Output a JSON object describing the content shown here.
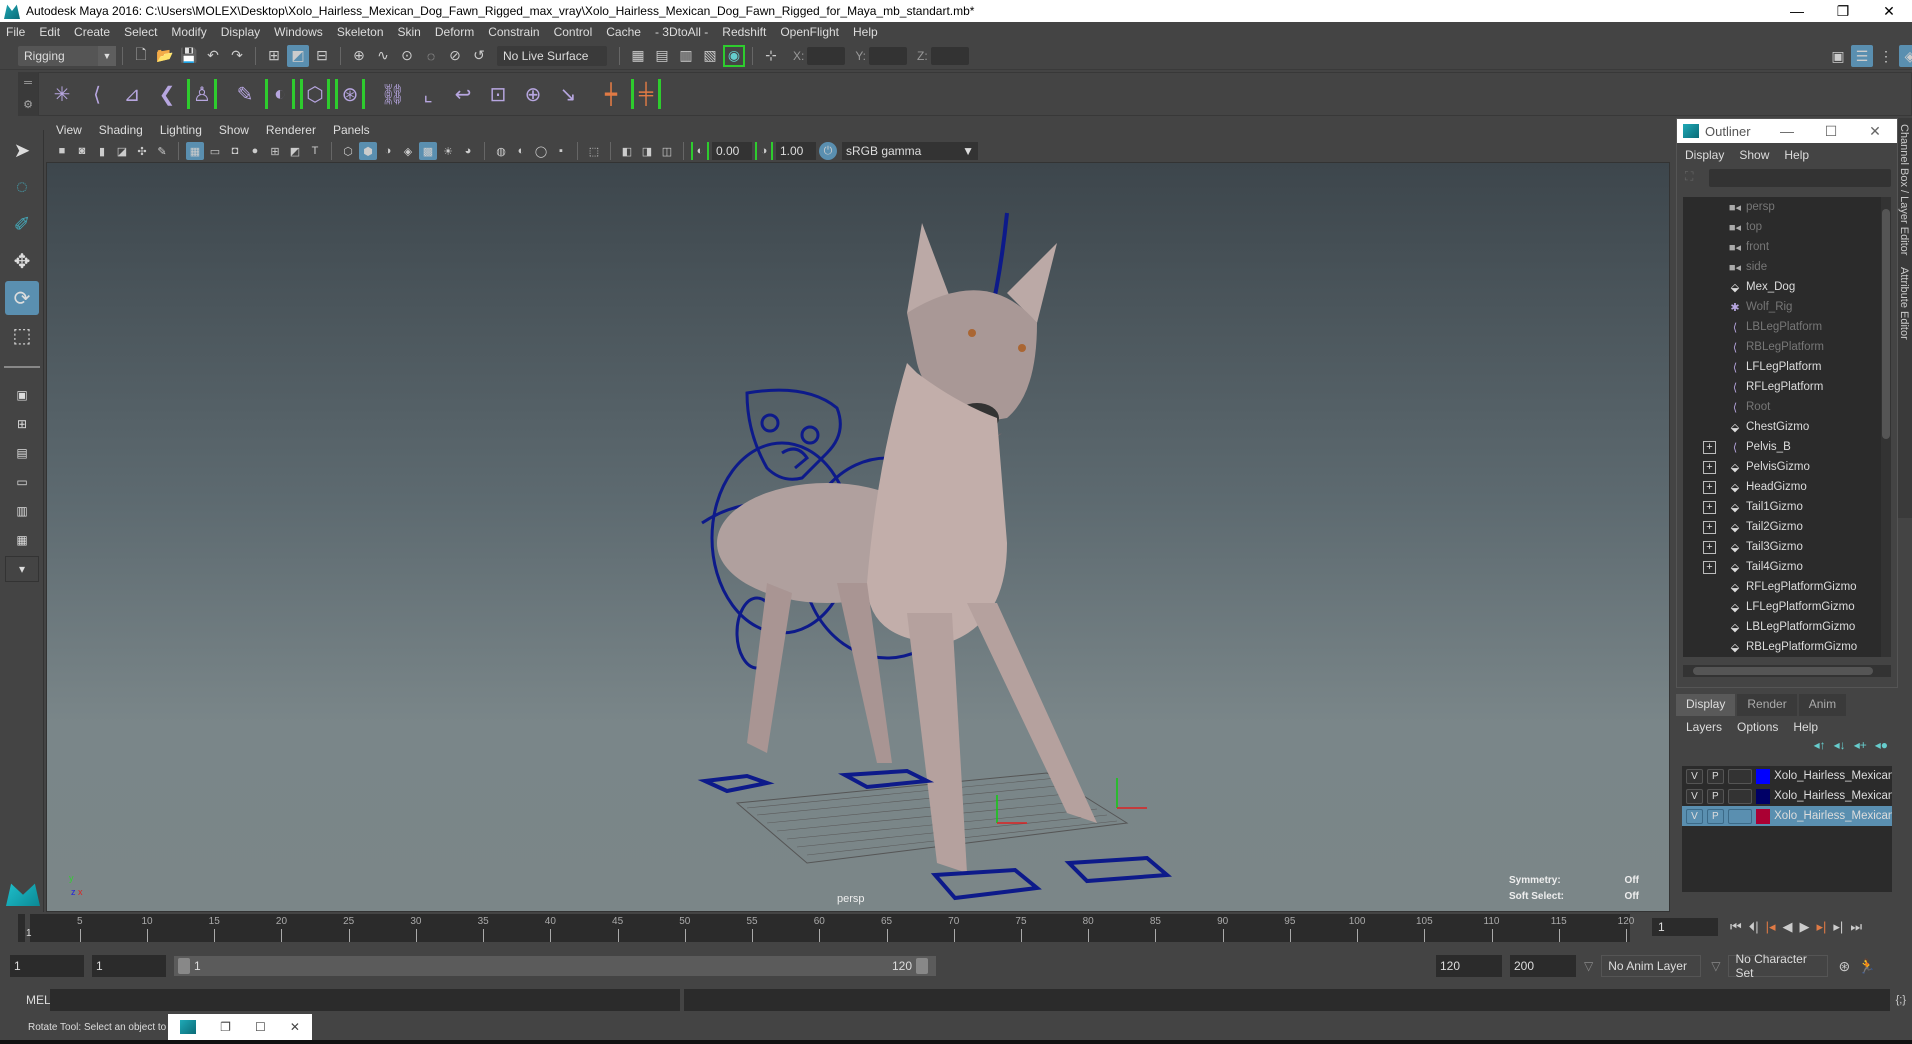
{
  "window": {
    "title": "Autodesk Maya 2016: C:\\Users\\MOLEX\\Desktop\\Xolo_Hairless_Mexican_Dog_Fawn_Rigged_max_vray\\Xolo_Hairless_Mexican_Dog_Fawn_Rigged_for_Maya_mb_standart.mb*",
    "min": "—",
    "max": "❐",
    "close": "✕"
  },
  "menu": [
    "File",
    "Edit",
    "Create",
    "Select",
    "Modify",
    "Display",
    "Windows",
    "Skeleton",
    "Skin",
    "Deform",
    "Constrain",
    "Control",
    "Cache",
    "- 3DtoAll -",
    "Redshift",
    "OpenFlight",
    "Help"
  ],
  "status": {
    "mode": "Rigging",
    "live_surface": "No Live Surface",
    "x_label": "X:",
    "y_label": "Y:",
    "z_label": "Z:"
  },
  "viewport": {
    "menu": [
      "View",
      "Shading",
      "Lighting",
      "Show",
      "Renderer",
      "Panels"
    ],
    "near": "0.00",
    "far": "1.00",
    "color_space": "sRGB gamma",
    "camera_label": "persp",
    "hud": {
      "symmetry_label": "Symmetry:",
      "symmetry_value": "Off",
      "soft_label": "Soft Select:",
      "soft_value": "Off"
    },
    "axis": {
      "y": "y",
      "z": "z",
      "x": "x"
    }
  },
  "outliner": {
    "title": "Outliner",
    "menu": [
      "Display",
      "Show",
      "Help"
    ],
    "items": [
      {
        "label": "persp",
        "icon": "camera",
        "dim": true,
        "expand": false
      },
      {
        "label": "top",
        "icon": "camera",
        "dim": true,
        "expand": false
      },
      {
        "label": "front",
        "icon": "camera",
        "dim": true,
        "expand": false
      },
      {
        "label": "side",
        "icon": "camera",
        "dim": true,
        "expand": false
      },
      {
        "label": "Mex_Dog",
        "icon": "mesh",
        "dim": false,
        "expand": false
      },
      {
        "label": "Wolf_Rig",
        "icon": "joint-star",
        "dim": true,
        "expand": false
      },
      {
        "label": "LBLegPlatform",
        "icon": "joint",
        "dim": true,
        "expand": false
      },
      {
        "label": "RBLegPlatform",
        "icon": "joint",
        "dim": true,
        "expand": false
      },
      {
        "label": "LFLegPlatform",
        "icon": "joint",
        "dim": false,
        "expand": false
      },
      {
        "label": "RFLegPlatform",
        "icon": "joint",
        "dim": false,
        "expand": false
      },
      {
        "label": "Root",
        "icon": "joint",
        "dim": true,
        "expand": false
      },
      {
        "label": "ChestGizmo",
        "icon": "mesh",
        "dim": false,
        "expand": false
      },
      {
        "label": "Pelvis_B",
        "icon": "joint",
        "dim": false,
        "expand": true
      },
      {
        "label": "PelvisGizmo",
        "icon": "mesh",
        "dim": false,
        "expand": true
      },
      {
        "label": "HeadGizmo",
        "icon": "mesh",
        "dim": false,
        "expand": true
      },
      {
        "label": "Tail1Gizmo",
        "icon": "mesh",
        "dim": false,
        "expand": true
      },
      {
        "label": "Tail2Gizmo",
        "icon": "mesh",
        "dim": false,
        "expand": true
      },
      {
        "label": "Tail3Gizmo",
        "icon": "mesh",
        "dim": false,
        "expand": true
      },
      {
        "label": "Tail4Gizmo",
        "icon": "mesh",
        "dim": false,
        "expand": true
      },
      {
        "label": "RFLegPlatformGizmo",
        "icon": "mesh",
        "dim": false,
        "expand": false
      },
      {
        "label": "LFLegPlatformGizmo",
        "icon": "mesh",
        "dim": false,
        "expand": false
      },
      {
        "label": "LBLegPlatformGizmo",
        "icon": "mesh",
        "dim": false,
        "expand": false
      },
      {
        "label": "RBLegPlatformGizmo",
        "icon": "mesh",
        "dim": false,
        "expand": false
      }
    ]
  },
  "side_tabs": {
    "channel_box": "Channel Box / Layer Editor",
    "attribute": "Attribute Editor"
  },
  "layer_editor": {
    "tabs": [
      "Display",
      "Render",
      "Anim"
    ],
    "active_tab": "Display",
    "menu": [
      "Layers",
      "Options",
      "Help"
    ],
    "layers": [
      {
        "v": "V",
        "p": "P",
        "color": "#0000ff",
        "name": "Xolo_Hairless_Mexican_",
        "selected": false
      },
      {
        "v": "V",
        "p": "P",
        "color": "#000066",
        "name": "Xolo_Hairless_Mexican_",
        "selected": false
      },
      {
        "v": "V",
        "p": "P",
        "color": "#aa0033",
        "name": "Xolo_Hairless_Mexican_",
        "selected": true
      }
    ]
  },
  "timeline": {
    "ticks": [
      5,
      10,
      15,
      20,
      25,
      30,
      35,
      40,
      45,
      50,
      55,
      60,
      65,
      70,
      75,
      80,
      85,
      90,
      95,
      100,
      105,
      110,
      115,
      120
    ],
    "start": 1,
    "end": 120,
    "current_frame": "1"
  },
  "range": {
    "start_field": "1",
    "start_inner": "1",
    "bar_start": "1",
    "bar_end": "120",
    "end_inner": "120",
    "end_field": "200",
    "anim_layer": "No Anim Layer",
    "char_set": "No Character Set"
  },
  "mel": {
    "label": "MEL"
  },
  "help_line": "Rotate Tool: Select an object to",
  "colors": {
    "accent": "#5a8fb0",
    "panel": "#444444",
    "rig_blue": "#0d1a8a"
  }
}
